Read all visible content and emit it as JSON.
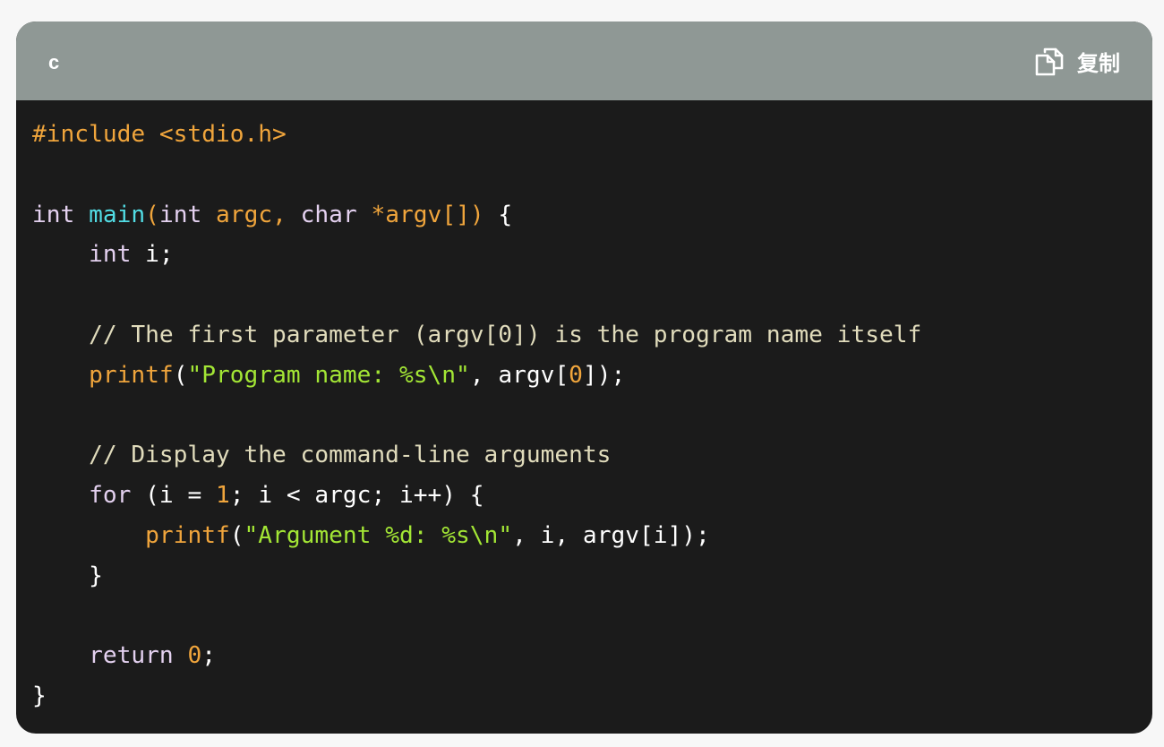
{
  "header": {
    "language": "c",
    "copy_label": "复制",
    "copy_icon": "copy-icon"
  },
  "code": {
    "lines": [
      [
        {
          "t": "#include <stdio.h>",
          "c": "pre"
        }
      ],
      [],
      [
        {
          "t": "int",
          "c": "kw"
        },
        {
          "t": " ",
          "c": "plain"
        },
        {
          "t": "main",
          "c": "fn"
        },
        {
          "t": "(",
          "c": "par"
        },
        {
          "t": "int",
          "c": "kw"
        },
        {
          "t": " argc, ",
          "c": "par"
        },
        {
          "t": "char",
          "c": "kw"
        },
        {
          "t": " *argv[]) ",
          "c": "par"
        },
        {
          "t": "{",
          "c": "plain"
        }
      ],
      [
        {
          "t": "    ",
          "c": "plain"
        },
        {
          "t": "int",
          "c": "kw"
        },
        {
          "t": " i;",
          "c": "plain"
        }
      ],
      [],
      [
        {
          "t": "    // The first parameter (argv[0]) is the program name itself",
          "c": "cmt"
        }
      ],
      [
        {
          "t": "    ",
          "c": "plain"
        },
        {
          "t": "printf",
          "c": "fnc"
        },
        {
          "t": "(",
          "c": "plain"
        },
        {
          "t": "\"Program name: %s\\n\"",
          "c": "str"
        },
        {
          "t": ", argv[",
          "c": "plain"
        },
        {
          "t": "0",
          "c": "num"
        },
        {
          "t": "]);",
          "c": "plain"
        }
      ],
      [],
      [
        {
          "t": "    // Display the command-line arguments",
          "c": "cmt"
        }
      ],
      [
        {
          "t": "    ",
          "c": "plain"
        },
        {
          "t": "for",
          "c": "kw"
        },
        {
          "t": " (i = ",
          "c": "plain"
        },
        {
          "t": "1",
          "c": "num"
        },
        {
          "t": "; i < argc; i++) {",
          "c": "plain"
        }
      ],
      [
        {
          "t": "        ",
          "c": "plain"
        },
        {
          "t": "printf",
          "c": "fnc"
        },
        {
          "t": "(",
          "c": "plain"
        },
        {
          "t": "\"Argument %d: %s\\n\"",
          "c": "str"
        },
        {
          "t": ", i, argv[i]);",
          "c": "plain"
        }
      ],
      [
        {
          "t": "    }",
          "c": "plain"
        }
      ],
      [],
      [
        {
          "t": "    ",
          "c": "plain"
        },
        {
          "t": "return",
          "c": "kw"
        },
        {
          "t": " ",
          "c": "plain"
        },
        {
          "t": "0",
          "c": "num"
        },
        {
          "t": ";",
          "c": "plain"
        }
      ],
      [
        {
          "t": "}",
          "c": "plain"
        }
      ]
    ]
  }
}
